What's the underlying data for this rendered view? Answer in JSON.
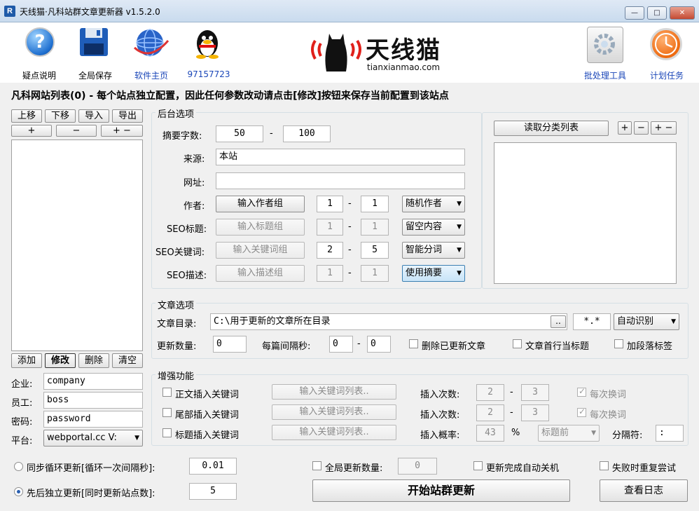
{
  "window": {
    "title": "天线猫·凡科站群文章更新器 v1.5.2.0",
    "app_icon": "R",
    "min": "—",
    "max": "□",
    "close": "✕"
  },
  "toolbar": {
    "help": "疑点说明",
    "save_all": "全局保存",
    "homepage": "软件主页",
    "qq": "97157723",
    "batch_tools": "批处理工具",
    "scheduled_tasks": "计划任务",
    "logo_text": "天线猫",
    "logo_url": "tianxianmao.com"
  },
  "heading": "凡科网站列表(0) - 每个站点独立配置，因此任何参数改动请点击[修改]按钮来保存当前配置到该站点",
  "site_list": {
    "move_up": "上移",
    "move_down": "下移",
    "import": "导入",
    "export": "导出",
    "plus": "+",
    "minus": "−",
    "plusminus": "+ −",
    "add": "添加",
    "modify": "修改",
    "delete": "删除",
    "clear": "清空"
  },
  "account": {
    "company_label": "企业:",
    "company_value": "company",
    "staff_label": "员工:",
    "staff_value": "boss",
    "password_label": "密码:",
    "password_value": "password",
    "platform_label": "平台:",
    "platform_value": "webportal.cc V:"
  },
  "backend": {
    "title": "后台选项",
    "summary_label": "摘要字数:",
    "summary_min": "50",
    "summary_max": "100",
    "dash": "-",
    "source_label": "来源:",
    "source_value": "本站",
    "url_label": "网址:",
    "url_value": "",
    "author_label": "作者:",
    "author_btn": "输入作者组",
    "author_min": "1",
    "author_max": "1",
    "author_mode": "随机作者",
    "seo_title_label": "SEO标题:",
    "seo_title_btn": "输入标题组",
    "seo_title_min": "1",
    "seo_title_max": "1",
    "seo_title_mode": "留空内容",
    "seo_kw_label": "SEO关键词:",
    "seo_kw_btn": "输入关键词组",
    "seo_kw_min": "2",
    "seo_kw_max": "5",
    "seo_kw_mode": "智能分词",
    "seo_desc_label": "SEO描述:",
    "seo_desc_btn": "输入描述组",
    "seo_desc_min": "1",
    "seo_desc_max": "1",
    "seo_desc_mode": "使用摘要"
  },
  "category": {
    "read_btn": "读取分类列表",
    "plus": "+",
    "minus": "−",
    "plusminus": "+ −"
  },
  "article": {
    "title": "文章选项",
    "dir_label": "文章目录:",
    "dir_value": "C:\\用于更新的文章所在目录",
    "browse": "..",
    "pattern": "*.*",
    "encoding": "自动识别",
    "count_label": "更新数量:",
    "count_value": "0",
    "interval_label": "每篇间隔秒:",
    "interval_min": "0",
    "interval_max": "0",
    "delete_updated": "删除已更新文章",
    "first_line_title": "文章首行当标题",
    "add_para_tag": "加段落标签"
  },
  "enhance": {
    "title": "增强功能",
    "body_kw": "正文插入关键词",
    "body_kw_btn": "输入关键词列表..",
    "body_count_label": "插入次数:",
    "body_min": "2",
    "body_max": "3",
    "body_change": "每次换词",
    "tail_kw": "尾部插入关键词",
    "tail_kw_btn": "输入关键词列表..",
    "tail_count_label": "插入次数:",
    "tail_min": "2",
    "tail_max": "3",
    "tail_change": "每次换词",
    "title_kw": "标题插入关键词",
    "title_kw_btn": "输入关键词列表..",
    "prob_label": "插入概率:",
    "prob_value": "43",
    "percent": "%",
    "position": "标题前",
    "sep_label": "分隔符:",
    "sep_value": ":"
  },
  "bottom": {
    "sync_loop": "同步循环更新[循环一次间隔秒]:",
    "sync_value": "0.01",
    "sequential": "先后独立更新[同时更新站点数]:",
    "seq_value": "5",
    "global_count": "全局更新数量:",
    "global_value": "0",
    "auto_shutdown": "更新完成自动关机",
    "retry": "失败时重复尝试",
    "start": "开始站群更新",
    "view_log": "查看日志"
  }
}
